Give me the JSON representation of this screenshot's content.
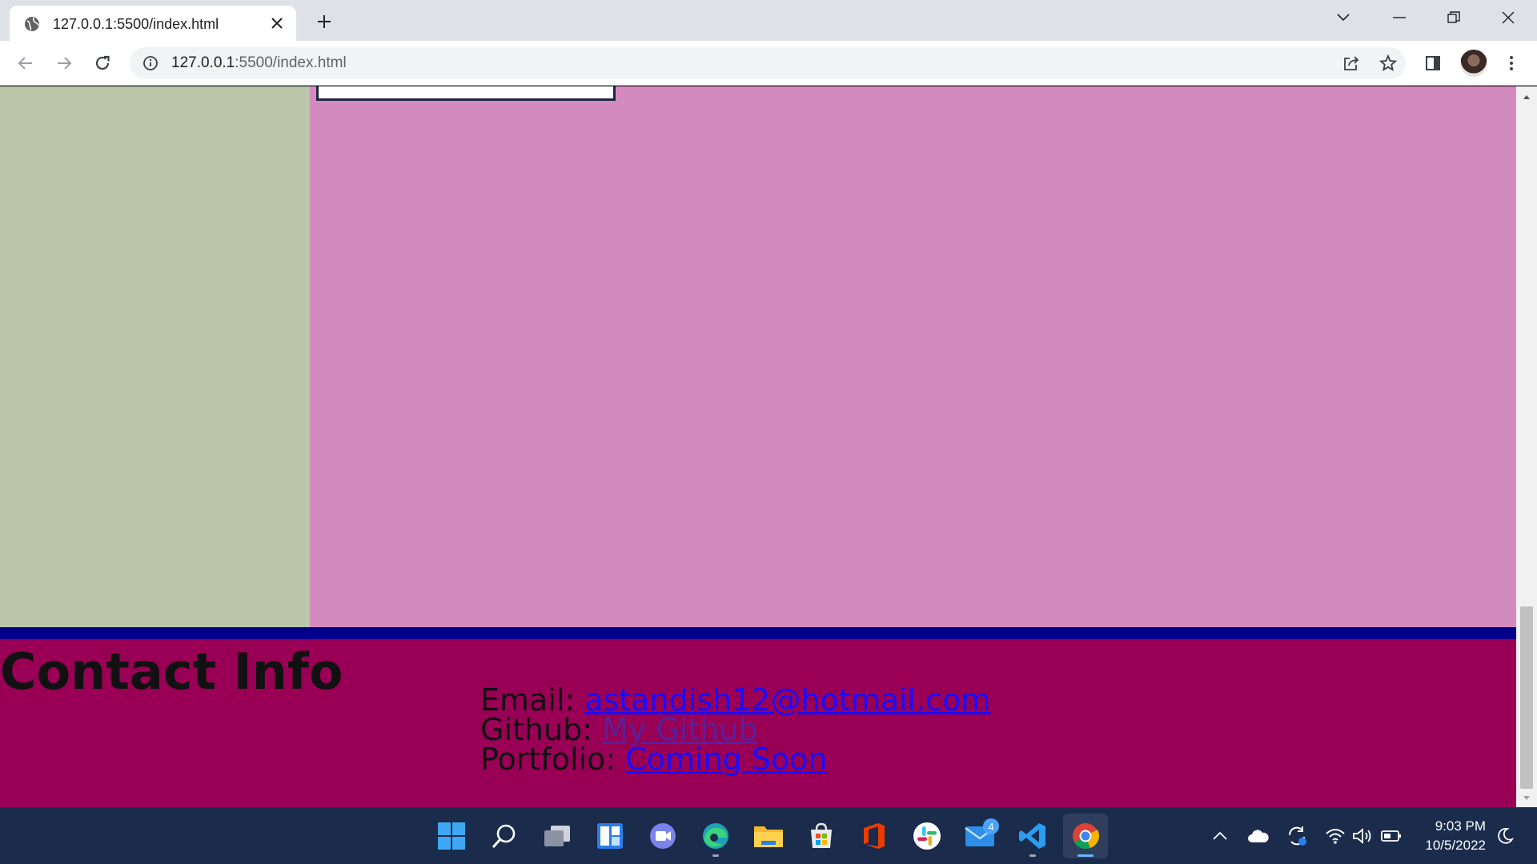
{
  "browser": {
    "tab_title": "127.0.0.1:5500/index.html",
    "url_host": "127.0.0.1",
    "url_rest": ":5500/index.html"
  },
  "page": {
    "footer_title": "Contact Info",
    "contacts": [
      {
        "label": "Email: ",
        "link_text": "astandish12@hotmail.com"
      },
      {
        "label": "Github: ",
        "link_text": "My Github"
      },
      {
        "label": "Portfolio: ",
        "link_text": "Coming Soon"
      }
    ],
    "colors": {
      "sidebar": "#b9c6aa",
      "main": "#d38bbf",
      "footer": "#990055",
      "stripe": "#00008b",
      "link": "#1a0dff"
    }
  },
  "taskbar": {
    "apps": [
      "windows-start",
      "search",
      "task-view",
      "widgets",
      "teams-chat",
      "edge",
      "file-explorer",
      "microsoft-store",
      "office",
      "slack",
      "mail",
      "vscode",
      "chrome"
    ],
    "mail_badge": "4",
    "time": "9:03 PM",
    "date": "10/5/2022"
  }
}
